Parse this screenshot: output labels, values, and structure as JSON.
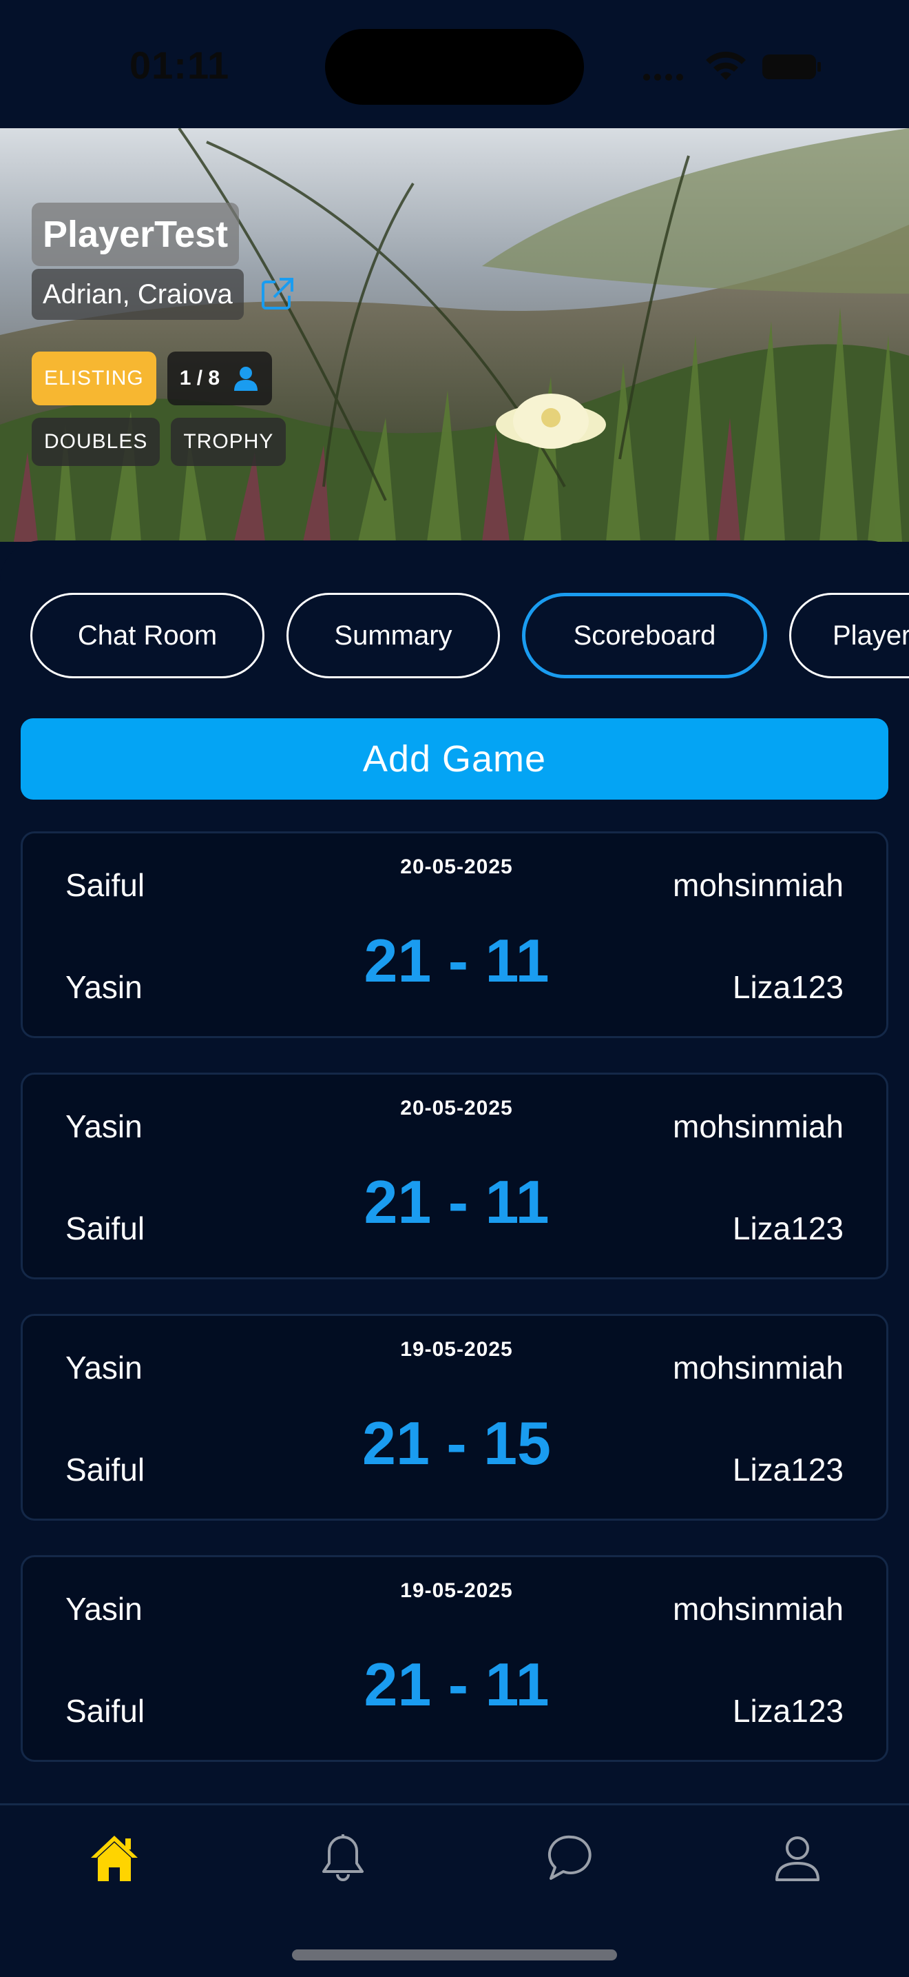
{
  "status_bar": {
    "time": "01:11",
    "icons": [
      "signal-icon",
      "wifi-icon",
      "battery-icon"
    ]
  },
  "event": {
    "title": "PlayerTest",
    "location": "Adrian, Craiova",
    "status_badge": "ELISTING",
    "players_count": "1 / 8",
    "tags": [
      "DOUBLES",
      "TROPHY"
    ]
  },
  "tabs": [
    {
      "label": "Chat Room",
      "active": false
    },
    {
      "label": "Summary",
      "active": false
    },
    {
      "label": "Scoreboard",
      "active": true
    },
    {
      "label": "Players",
      "active": false
    }
  ],
  "add_game_label": "Add Game",
  "games": [
    {
      "date": "20-05-2025",
      "team1_top": "Saiful",
      "team1_bottom": "Yasin",
      "team2_top": "mohsinmiah",
      "team2_bottom": "Liza123",
      "score": "21 - 11"
    },
    {
      "date": "20-05-2025",
      "team1_top": "Yasin",
      "team1_bottom": "Saiful",
      "team2_top": "mohsinmiah",
      "team2_bottom": "Liza123",
      "score": "21 - 11"
    },
    {
      "date": "19-05-2025",
      "team1_top": "Yasin",
      "team1_bottom": "Saiful",
      "team2_top": "mohsinmiah",
      "team2_bottom": "Liza123",
      "score": "21 - 15"
    },
    {
      "date": "19-05-2025",
      "team1_top": "Yasin",
      "team1_bottom": "Saiful",
      "team2_top": "mohsinmiah",
      "team2_bottom": "Liza123",
      "score": "21 - 11"
    }
  ],
  "bottom_nav": {
    "items": [
      "home-icon",
      "bell-icon",
      "chat-icon",
      "profile-icon"
    ],
    "active": "home-icon"
  },
  "colors": {
    "background": "#04112a",
    "accent": "#1a9cf0",
    "button": "#04a4f4",
    "status_badge": "#f7b731",
    "nav_active": "#ffd400"
  }
}
